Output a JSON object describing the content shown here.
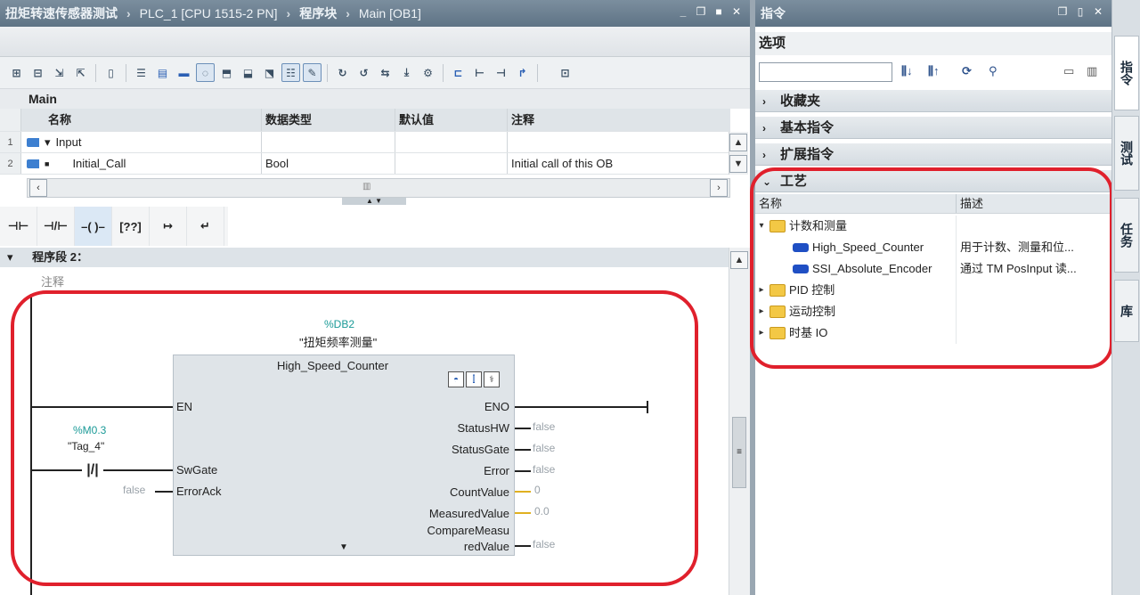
{
  "editor": {
    "breadcrumb": [
      "扭矩转速传感器测试",
      "PLC_1 [CPU 1515-2 PN]",
      "程序块",
      "Main [OB1]"
    ],
    "block_name": "Main",
    "interface": {
      "columns": [
        "名称",
        "数据类型",
        "默认值",
        "注释"
      ],
      "rows": [
        {
          "num": "1",
          "name": "Input",
          "type": "",
          "default": "",
          "comment": ""
        },
        {
          "num": "2",
          "name": "Initial_Call",
          "type": "Bool",
          "default": "",
          "comment": "Initial call of this OB"
        }
      ]
    },
    "network": {
      "title": "程序段 2：",
      "comment_placeholder": "注释",
      "instance_db": "%DB2",
      "instance_name": "\"扭矩频率测量\"",
      "block_type": "High_Speed_Counter",
      "inputs": [
        "EN",
        "SwGate",
        "ErrorAck"
      ],
      "outputs": [
        "ENO",
        "StatusHW",
        "StatusGate",
        "Error",
        "CountValue",
        "MeasuredValue",
        "CompareMeasu",
        "redValue"
      ],
      "contact_address": "%M0.3",
      "contact_name": "\"Tag_4\"",
      "erroracck_value": "false",
      "out_values": {
        "StatusHW": "false",
        "StatusGate": "false",
        "Error": "false",
        "CountValue": "0",
        "MeasuredValue": "0.0",
        "CompareMeasuredValue": "false"
      }
    }
  },
  "instructions": {
    "title": "指令",
    "options_label": "选项",
    "search_value": "",
    "panes": [
      "收藏夹",
      "基本指令",
      "扩展指令",
      "工艺"
    ],
    "columns": [
      "名称",
      "描述"
    ],
    "tree": [
      {
        "name": "计数和测量",
        "desc": "",
        "kind": "folder-open"
      },
      {
        "name": "High_Speed_Counter",
        "desc": "用于计数、测量和位...",
        "kind": "fb"
      },
      {
        "name": "SSI_Absolute_Encoder",
        "desc": "通过 TM PosInput 读...",
        "kind": "fb"
      },
      {
        "name": "PID 控制",
        "desc": "",
        "kind": "folder"
      },
      {
        "name": "运动控制",
        "desc": "",
        "kind": "folder"
      },
      {
        "name": "时基 IO",
        "desc": "",
        "kind": "folder"
      }
    ]
  },
  "side_tabs": [
    "指令",
    "测试",
    "任务",
    "库"
  ],
  "colors": {
    "accent": "#e0202c",
    "tag": "#1a9a97",
    "fb_block": "#dfe4e8"
  }
}
